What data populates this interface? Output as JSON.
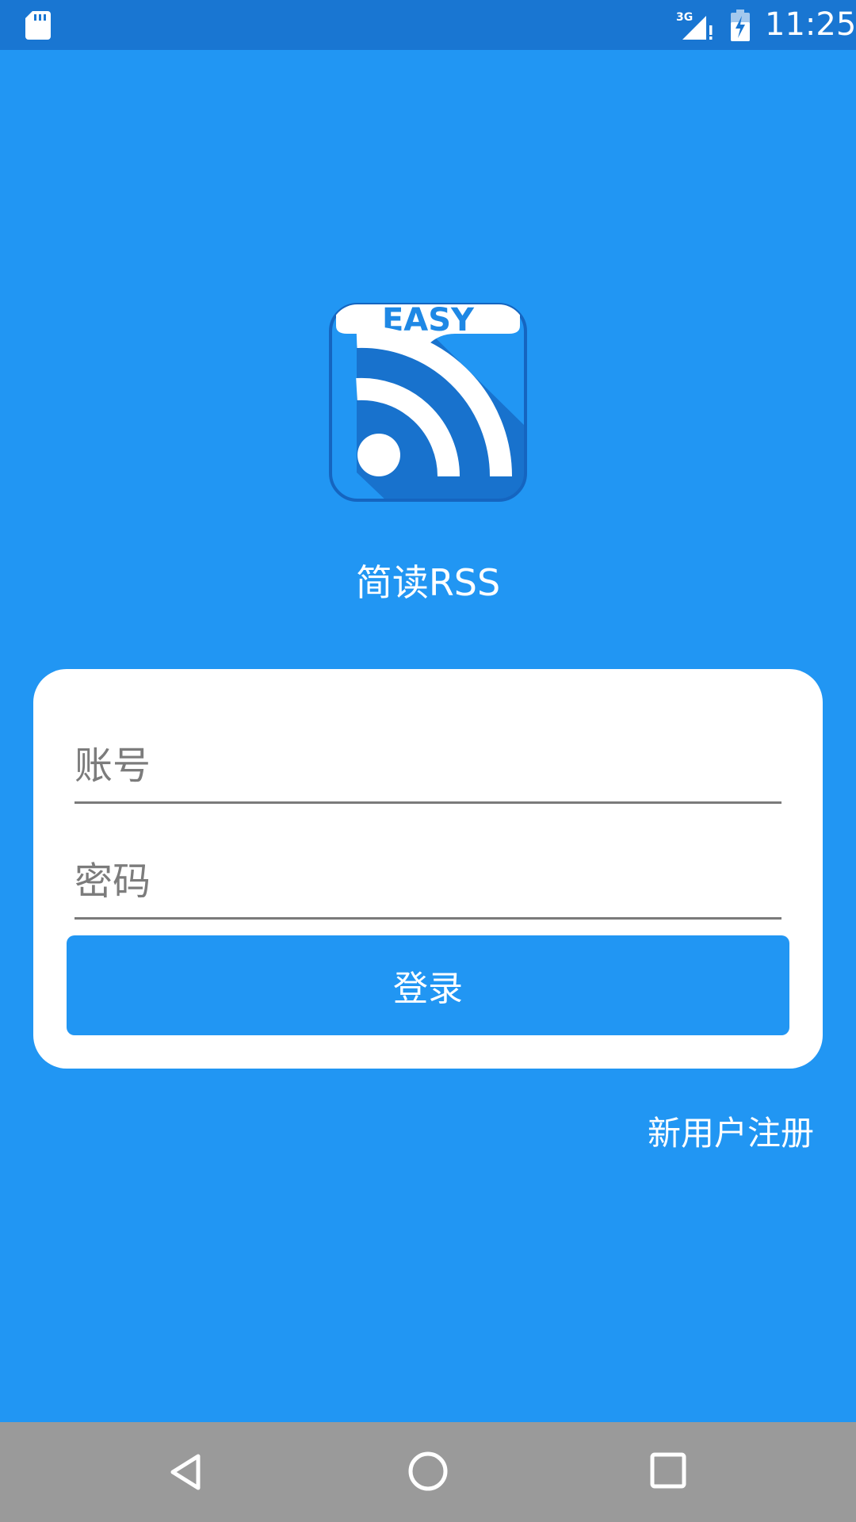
{
  "status_bar": {
    "network_type": "3G",
    "time": "11:25",
    "icons": [
      "sd-card-icon",
      "cell-signal-icon",
      "battery-charging-icon"
    ]
  },
  "logo": {
    "badge_text": "EASY",
    "icon": "rss-feed-icon"
  },
  "app_name": "简读RSS",
  "login_form": {
    "account_placeholder": "账号",
    "account_value": "",
    "password_placeholder": "密码",
    "password_value": "",
    "login_button_label": "登录"
  },
  "register_link": "新用户注册",
  "nav_bar": {
    "icons": [
      "back-icon",
      "home-icon",
      "recents-icon"
    ]
  },
  "colors": {
    "background": "#2196F3",
    "status_bar": "#1976D2",
    "card": "#FFFFFF",
    "button": "#2196F3",
    "nav_bar": "#9A9A9A",
    "logo_dark": "#1565C0"
  }
}
